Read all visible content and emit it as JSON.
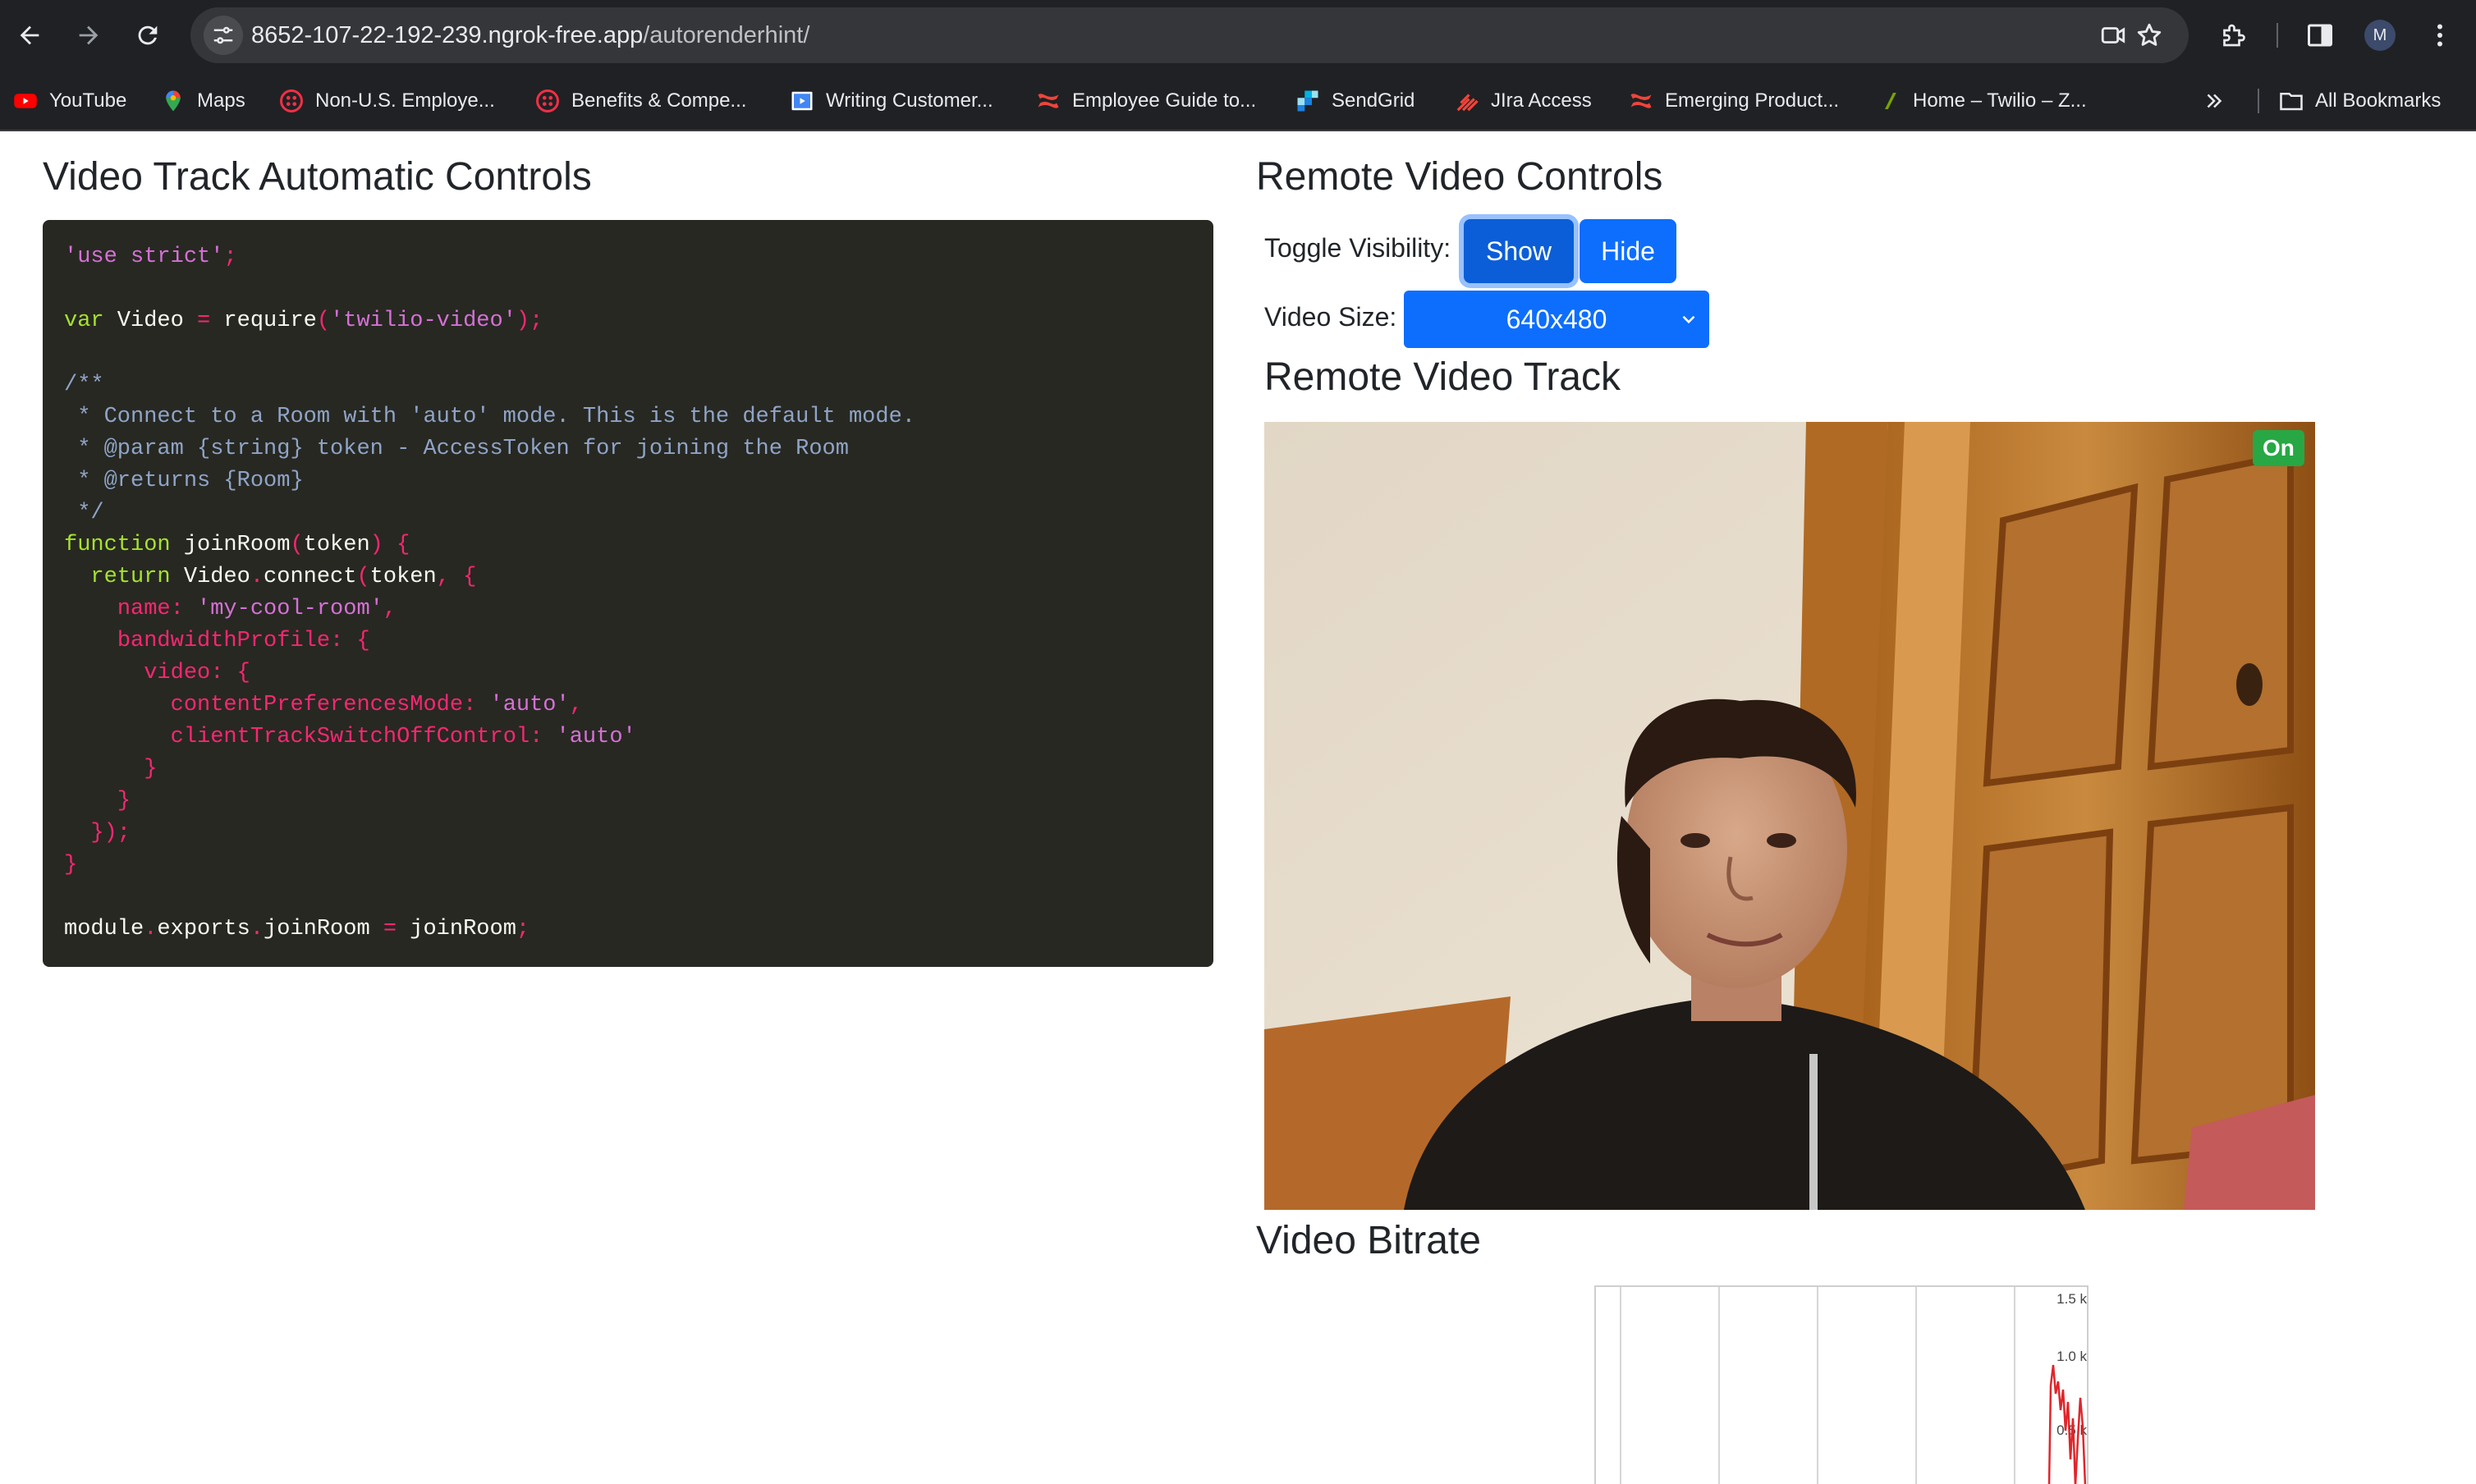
{
  "browser": {
    "url_host": "8652-107-22-192-239.ngrok-free.app",
    "url_path": "/autorenderhint/",
    "profile_initial": "M",
    "bookmarks": [
      {
        "label": "YouTube",
        "icon": "youtube-icon",
        "color": "#ff0000"
      },
      {
        "label": "Maps",
        "icon": "maps-pin-icon",
        "color": "#34a853"
      },
      {
        "label": "Non-U.S. Employe...",
        "icon": "twilio-icon",
        "color": "#f22f46"
      },
      {
        "label": "Benefits & Compe...",
        "icon": "twilio-icon",
        "color": "#f22f46"
      },
      {
        "label": "Writing Customer...",
        "icon": "video-doc-icon",
        "color": "#4285f4"
      },
      {
        "label": "Employee Guide to...",
        "icon": "confluence-icon",
        "color": "#f0443a"
      },
      {
        "label": "SendGrid",
        "icon": "sendgrid-icon",
        "color": "#1a82e2"
      },
      {
        "label": "JIra Access",
        "icon": "jira-icon",
        "color": "#f0443a"
      },
      {
        "label": "Emerging Product...",
        "icon": "confluence-icon",
        "color": "#f0443a"
      },
      {
        "label": "Home – Twilio – Z...",
        "icon": "zendesk-icon",
        "color": "#78a300"
      }
    ],
    "all_bookmarks_label": "All Bookmarks"
  },
  "left": {
    "title": "Video Track Automatic Controls"
  },
  "right": {
    "title": "Remote Video Controls",
    "toggle_label": "Toggle Visibility:",
    "show_label": "Show",
    "hide_label": "Hide",
    "size_label": "Video Size:",
    "size_value": "640x480",
    "track_title": "Remote Video Track",
    "status_badge": "On",
    "bitrate_title": "Video Bitrate",
    "graph_ticks": [
      "1.5 k",
      "1.0 k",
      "0.5 k"
    ]
  },
  "colors": {
    "primary": "#0d6efd",
    "badge_green": "#28a745",
    "code_bg": "#272822",
    "graph_line": "#e0262b"
  }
}
